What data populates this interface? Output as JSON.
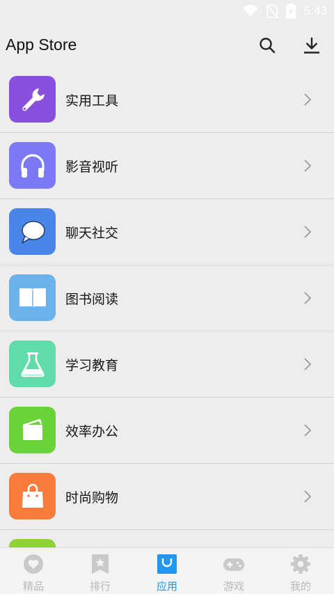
{
  "status": {
    "time": "5:43"
  },
  "header": {
    "title": "App Store",
    "search_icon": "search-icon",
    "download_icon": "download-icon"
  },
  "categories": [
    {
      "label": "实用工具",
      "color": "#8a4fdd",
      "icon": "wrench-icon"
    },
    {
      "label": "影音视听",
      "color": "#7b79f3",
      "icon": "headphones-icon"
    },
    {
      "label": "聊天社交",
      "color": "#4a86e8",
      "icon": "chat-bubble-icon"
    },
    {
      "label": "图书阅读",
      "color": "#6cb2ea",
      "icon": "open-book-icon"
    },
    {
      "label": "学习教育",
      "color": "#5fdca8",
      "icon": "flask-icon"
    },
    {
      "label": "效率办公",
      "color": "#6bd33a",
      "icon": "wallet-icon"
    },
    {
      "label": "时尚购物",
      "color": "#f87b3b",
      "icon": "shopping-bag-icon"
    },
    {
      "label": "",
      "color": "#8fd236",
      "icon": "partial-icon"
    }
  ],
  "bottom_nav": {
    "items": [
      {
        "label": "精品",
        "icon": "heart-icon",
        "active": false
      },
      {
        "label": "排行",
        "icon": "bookmark-star-icon",
        "active": false
      },
      {
        "label": "应用",
        "icon": "app-bag-icon",
        "active": true
      },
      {
        "label": "游戏",
        "icon": "gamepad-icon",
        "active": false
      },
      {
        "label": "我的",
        "icon": "gear-icon",
        "active": false
      }
    ],
    "active_color": "#2196f3",
    "inactive_color": "#b9b9b9"
  }
}
